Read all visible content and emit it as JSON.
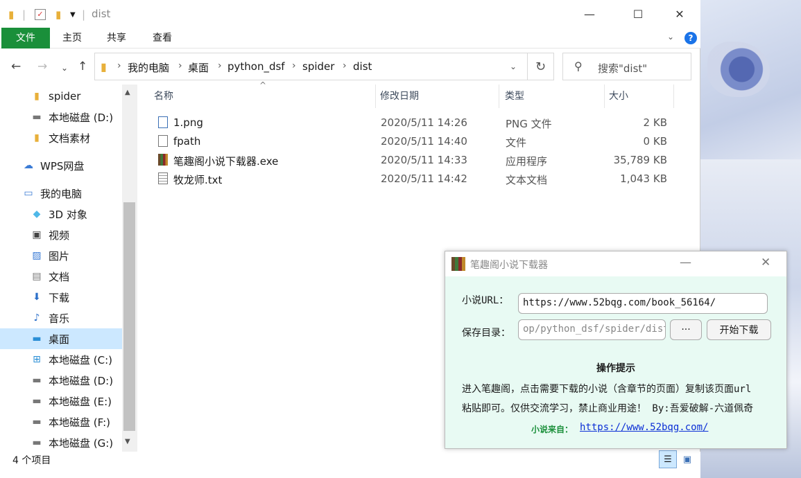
{
  "explorer": {
    "title": "dist",
    "ribbon_tabs": [
      "文件",
      "主页",
      "共享",
      "查看"
    ],
    "breadcrumb": [
      "我的电脑",
      "桌面",
      "python_dsf",
      "spider",
      "dist"
    ],
    "search_placeholder": "搜索\"dist\"",
    "sidebar": [
      {
        "label": "spider",
        "icon": "folder-icon"
      },
      {
        "label": "本地磁盘 (D:)",
        "icon": "drive-icon"
      },
      {
        "label": "文档素材",
        "icon": "folder-icon"
      },
      {
        "label": "WPS网盘",
        "icon": "cloud-icon"
      },
      {
        "label": "我的电脑",
        "icon": "computer-icon"
      },
      {
        "label": "3D 对象",
        "icon": "cube-icon"
      },
      {
        "label": "视频",
        "icon": "video-icon"
      },
      {
        "label": "图片",
        "icon": "picture-icon"
      },
      {
        "label": "文档",
        "icon": "document-icon"
      },
      {
        "label": "下载",
        "icon": "download-icon"
      },
      {
        "label": "音乐",
        "icon": "music-icon"
      },
      {
        "label": "桌面",
        "icon": "desktop-icon"
      },
      {
        "label": "本地磁盘 (C:)",
        "icon": "windows-drive-icon"
      },
      {
        "label": "本地磁盘 (D:)",
        "icon": "drive-icon"
      },
      {
        "label": "本地磁盘 (E:)",
        "icon": "drive-icon"
      },
      {
        "label": "本地磁盘 (F:)",
        "icon": "drive-icon"
      },
      {
        "label": "本地磁盘 (G:)",
        "icon": "drive-icon"
      }
    ],
    "columns": [
      "名称",
      "修改日期",
      "类型",
      "大小"
    ],
    "files": [
      {
        "name": "1.png",
        "date": "2020/5/11 14:26",
        "type": "PNG 文件",
        "size": "2 KB",
        "icon": "image-file-icon"
      },
      {
        "name": "fpath",
        "date": "2020/5/11 14:40",
        "type": "文件",
        "size": "0 KB",
        "icon": "blank-file-icon"
      },
      {
        "name": "笔趣阁小说下载器.exe",
        "date": "2020/5/11 14:33",
        "type": "应用程序",
        "size": "35,789 KB",
        "icon": "books-app-icon"
      },
      {
        "name": "牧龙师.txt",
        "date": "2020/5/11 14:42",
        "type": "文本文档",
        "size": "1,043 KB",
        "icon": "text-file-icon"
      }
    ],
    "status": "4 个项目"
  },
  "dialog": {
    "title": "笔趣阁小说下载器",
    "url_label": "小说URL：",
    "url_value": "https://www.52bqg.com/book_56164/",
    "dir_label": "保存目录：",
    "dir_value": "op/python_dsf/spider/dist",
    "browse_label": "···",
    "start_label": "开始下载",
    "tip_title": "操作提示",
    "tip_line1": "进入笔趣阁，点击需要下载的小说（含章节的页面）复制该页面url",
    "tip_line2": "粘贴即可。仅供交流学习，禁止商业用途！ By:吾爱破解-六道佩奇",
    "source_label": "小说来自：",
    "source_link": "https://www.52bqg.com/"
  }
}
